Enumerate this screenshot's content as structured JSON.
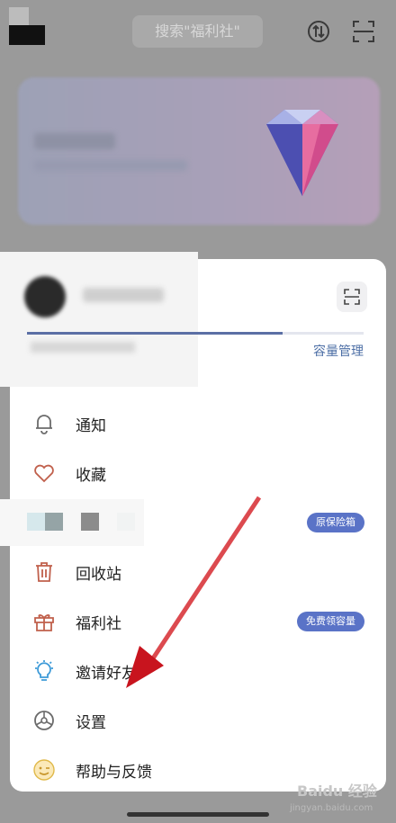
{
  "header": {
    "search_placeholder": "搜索\"福利社\""
  },
  "account": {
    "storage_used_fraction": 0.76,
    "manage_label": "容量管理"
  },
  "menu": [
    {
      "label": "通知",
      "icon": "bell-icon"
    },
    {
      "label": "收藏",
      "icon": "heart-icon"
    },
    {
      "label": "",
      "icon": "vault-icon",
      "badge": "原保险箱"
    },
    {
      "label": "回收站",
      "icon": "trash-icon"
    },
    {
      "label": "福利社",
      "icon": "gift-icon",
      "badge": "免费领容量"
    },
    {
      "label": "邀请好友",
      "icon": "lightbulb-icon"
    },
    {
      "label": "设置",
      "icon": "settings-icon"
    },
    {
      "label": "帮助与反馈",
      "icon": "smile-icon"
    }
  ],
  "watermark": {
    "brand": "Baidu 经验",
    "url": "jingyan.baidu.com"
  },
  "colors": {
    "accent": "#5b6fa5",
    "badge": "#5a73c7",
    "arrow": "#d0202a"
  }
}
